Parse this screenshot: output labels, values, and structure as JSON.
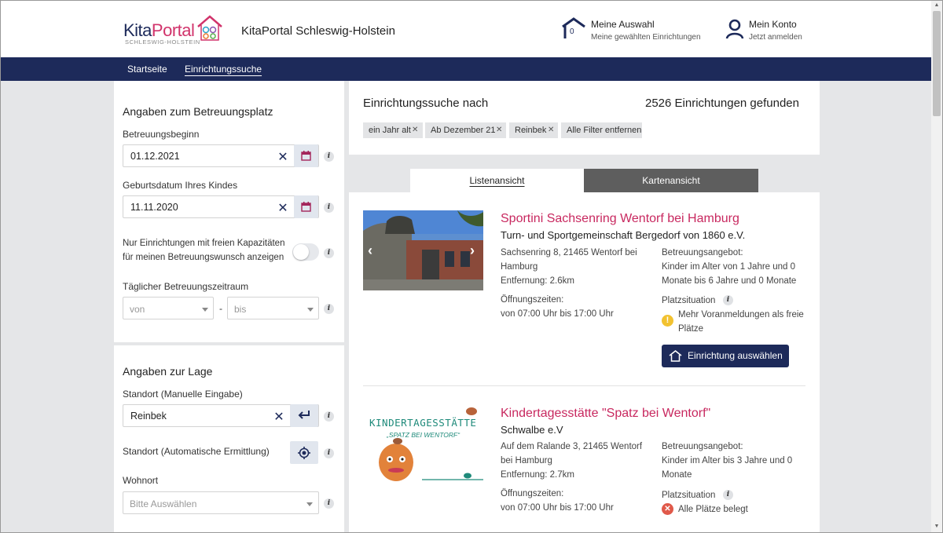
{
  "header": {
    "logo_main": "Kita",
    "logo_accent": "Portal",
    "logo_sub": "SCHLESWIG-HOLSTEIN",
    "site_title": "KitaPortal Schleswig-Holstein",
    "selection": {
      "title": "Meine Auswahl",
      "subtitle": "Meine gewählten Einrichtungen",
      "count": "0",
      "icon": "house-icon"
    },
    "account": {
      "title": "Mein Konto",
      "subtitle": "Jetzt anmelden",
      "icon": "user-icon"
    }
  },
  "nav": {
    "items": [
      "Startseite",
      "Einrichtungssuche"
    ],
    "active": "Einrichtungssuche"
  },
  "sidebar": {
    "care": {
      "title": "Angaben zum Betreuungsplatz",
      "start_label": "Betreuungsbeginn",
      "start_value": "01.12.2021",
      "birth_label": "Geburtsdatum Ihres Kindes",
      "birth_value": "11.11.2020",
      "free_label_1": "Nur Einrichtungen mit freien Kapazitäten",
      "free_label_2": "für meinen Betreuungswunsch anzeigen",
      "period_label": "Täglicher Betreuungszeitraum",
      "from_placeholder": "von",
      "dash": "-",
      "to_placeholder": "bis"
    },
    "location": {
      "title": "Angaben zur Lage",
      "manual_label": "Standort (Manuelle Eingabe)",
      "manual_value": "Reinbek",
      "auto_label": "Standort (Automatische Ermittlung)",
      "residence_label": "Wohnort",
      "residence_placeholder": "Bitte Auswählen"
    }
  },
  "search": {
    "heading": "Einrichtungssuche nach",
    "result_count": "2526 Einrichtungen gefunden",
    "filters": [
      "ein Jahr alt",
      "Ab Dezember 21",
      "Reinbek"
    ],
    "clear_all": "Alle Filter entfernen"
  },
  "tabs": {
    "list": "Listenansicht",
    "map": "Kartenansicht",
    "active": "list"
  },
  "results": [
    {
      "name": "Sportini Sachsenring Wentorf bei Hamburg",
      "operator": "Turn- und Sportgemeinschaft Bergedorf von 1860 e.V.",
      "address_1": "Sachsenring 8, 21465 Wentorf bei",
      "address_2": "Hamburg",
      "distance": "Entfernung: 2.6km",
      "hours_label": "Öffnungszeiten:",
      "hours": "von 07:00 Uhr bis 17:00 Uhr",
      "offer_label": "Betreuungsangebot:",
      "offer_1": "Kinder im Alter von 1 Jahre und 0",
      "offer_2": "Monate bis 6 Jahre und 0 Monate",
      "situation_label": "Platzsituation",
      "status_1": "Mehr Voranmeldungen als freie",
      "status_2": "Plätze",
      "status_color": "#f2c230",
      "button": "Einrichtung auswählen"
    },
    {
      "name": "Kindertagesstätte \"Spatz bei Wentorf\"",
      "operator": "Schwalbe e.V",
      "address_1": "Auf dem Ralande 3, 21465 Wentorf",
      "address_2": "bei Hamburg",
      "distance": "Entfernung: 2.7km",
      "hours_label": "Öffnungszeiten:",
      "hours": "von 07:00 Uhr bis 17:00 Uhr",
      "offer_label": "Betreuungsangebot:",
      "offer_1": "Kinder im Alter bis 3 Jahre und 0",
      "offer_2": "Monate",
      "situation_label": "Platzsituation",
      "status_1": "Alle Plätze belegt",
      "status_color": "#e0594a",
      "logo_line_1": "KINDERTAGESSTÄTTE",
      "logo_line_2": "„SPATZ BEI WENTORF“"
    }
  ],
  "colors": {
    "navy": "#1d2a5a",
    "pink": "#c8285f",
    "warning": "#f2c230",
    "error": "#e0594a"
  }
}
